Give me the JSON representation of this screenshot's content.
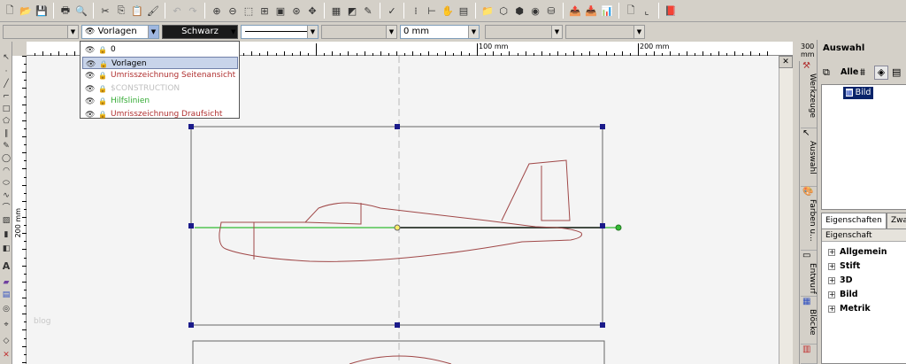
{
  "toolbar2": {
    "layer_value": "Vorlagen",
    "color_value": "Schwarz",
    "thickness_value": "0 mm"
  },
  "layers": [
    {
      "label": "0",
      "color": "#000000"
    },
    {
      "label": "Vorlagen",
      "color": "#000000"
    },
    {
      "label": "Umrisszeichnung Seitenansicht",
      "color": "#b03030"
    },
    {
      "label": "$CONSTRUCTION",
      "color": "#c0c0c0"
    },
    {
      "label": "Hilfslinien",
      "color": "#33aa33"
    },
    {
      "label": "Umrisszeichnung Draufsicht",
      "color": "#b03030"
    }
  ],
  "ruler": {
    "h_labels": [
      "100 mm",
      "200 mm",
      "300 mm"
    ],
    "v_label": "200 mm"
  },
  "canvas": {
    "watermark": "blog"
  },
  "vtabs": [
    "Werkzeuge",
    "Auswahl",
    "Farben u...",
    "Entwurf",
    "Blöcke"
  ],
  "panel": {
    "title": "Auswahl",
    "alle_label": "Alle",
    "tree_item": "Bild",
    "tab1": "Eigenschaften",
    "tab2": "Zwa",
    "prop_header": "Eigenschaft",
    "props": [
      "Allgemein",
      "Stift",
      "3D",
      "Bild",
      "Metrik"
    ]
  },
  "colors": {
    "outline": "#a04848",
    "guide": "#33bb33",
    "handle": "#1a1a8a"
  }
}
